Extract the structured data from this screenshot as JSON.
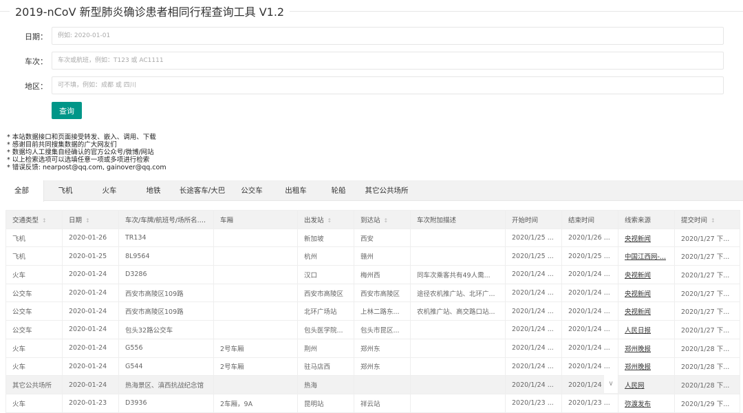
{
  "title": "2019-nCoV 新型肺炎确诊患者相同行程查询工具 V1.2",
  "form": {
    "date_label": "日期：",
    "date_placeholder": "例如: 2020-01-01",
    "train_label": "车次：",
    "train_placeholder": "车次或航班，例如：T123 或 AC1111",
    "area_label": "地区：",
    "area_placeholder": "可不填，例如：成都 或 四川",
    "submit": "查询"
  },
  "notes": [
    "* 本站数据接口和页面接受转发、嵌入、调用、下载",
    "* 感谢目前共同搜集数据的广大网友们",
    "* 数据均人工搜集自经确认的官方公众号/微博/网站",
    "* 以上检索选项可以选填任意一项或多项进行检索",
    "* 错误反馈: nearpost@qq.com, gainover@qq.com"
  ],
  "tabs": [
    "全部",
    "飞机",
    "火车",
    "地铁",
    "长途客车/大巴",
    "公交车",
    "出租车",
    "轮船",
    "其它公共场所"
  ],
  "active_tab": 0,
  "table": {
    "headers": [
      {
        "label": "交通类型",
        "sort": true
      },
      {
        "label": "日期",
        "sort": true
      },
      {
        "label": "车次/车牌/航班号/场所名...",
        "sort": true
      },
      {
        "label": "车厢",
        "sort": false
      },
      {
        "label": "出发站",
        "sort": true
      },
      {
        "label": "到达站",
        "sort": true
      },
      {
        "label": "车次附加描述",
        "sort": false
      },
      {
        "label": "开始时间",
        "sort": false
      },
      {
        "label": "结束时间",
        "sort": false
      },
      {
        "label": "线索来源",
        "sort": false
      },
      {
        "label": "提交时间",
        "sort": true
      }
    ],
    "rows": [
      [
        "飞机",
        "2020-01-26",
        "TR134",
        "",
        "新加坡",
        "西安",
        "",
        "2020/1/25 ...",
        "2020/1/26 ...",
        "央视新闻",
        "2020/1/27 下..."
      ],
      [
        "飞机",
        "2020-01-25",
        "8L9564",
        "",
        "杭州",
        "赣州",
        "",
        "2020/1/25 ...",
        "2020/1/25 ...",
        "中国江西网-...",
        "2020/1/27 下..."
      ],
      [
        "火车",
        "2020-01-24",
        "D3286",
        "",
        "汉口",
        "梅州西",
        "同车次乘客共有49人需...",
        "2020/1/24 ...",
        "2020/1/24 ...",
        "央视新闻",
        "2020/1/27 下..."
      ],
      [
        "公交车",
        "2020-01-24",
        "西安市高陵区109路",
        "",
        "西安市高陵区",
        "西安市高陵区",
        "途径农机推广站、北环广...",
        "2020/1/24 ...",
        "2020/1/24 ...",
        "央视新闻",
        "2020/1/27 下..."
      ],
      [
        "公交车",
        "2020-01-24",
        "西安市高陵区109路",
        "",
        "北环广场站",
        "上林二路东...",
        "农机推广站、高交路口站...",
        "2020/1/24 ...",
        "2020/1/24 ...",
        "央视新闻",
        "2020/1/27 下..."
      ],
      [
        "公交车",
        "2020-01-24",
        "包头32路公交车",
        "",
        "包头医学院...",
        "包头市昆区...",
        "",
        "2020/1/24 ...",
        "2020/1/24 ...",
        "人民日报",
        "2020/1/27 下..."
      ],
      [
        "火车",
        "2020-01-24",
        "G556",
        "2号车厢",
        "荆州",
        "郑州东",
        "",
        "2020/1/24 ...",
        "2020/1/24 ...",
        "郑州晚报",
        "2020/1/28 下..."
      ],
      [
        "火车",
        "2020-01-24",
        "G544",
        "2号车厢",
        "驻马店西",
        "郑州东",
        "",
        "2020/1/24 ...",
        "2020/1/24 ...",
        "郑州晚报",
        "2020/1/28 下..."
      ],
      [
        "其它公共场所",
        "2020-01-24",
        "热海景区、滇西抗战纪念馆",
        "",
        "热海",
        "",
        "",
        "2020/1/24 ...",
        "2020/1/24 ...",
        "人民网",
        "2020/1/28 下..."
      ],
      [
        "火车",
        "2020-01-23",
        "D3936",
        "2车厢，9A",
        "昆明站",
        "祥云站",
        "",
        "2020/1/23 ...",
        "2020/1/23 ...",
        "弥渡发布",
        "2020/1/29 下..."
      ]
    ],
    "highlighted_row": 8
  }
}
